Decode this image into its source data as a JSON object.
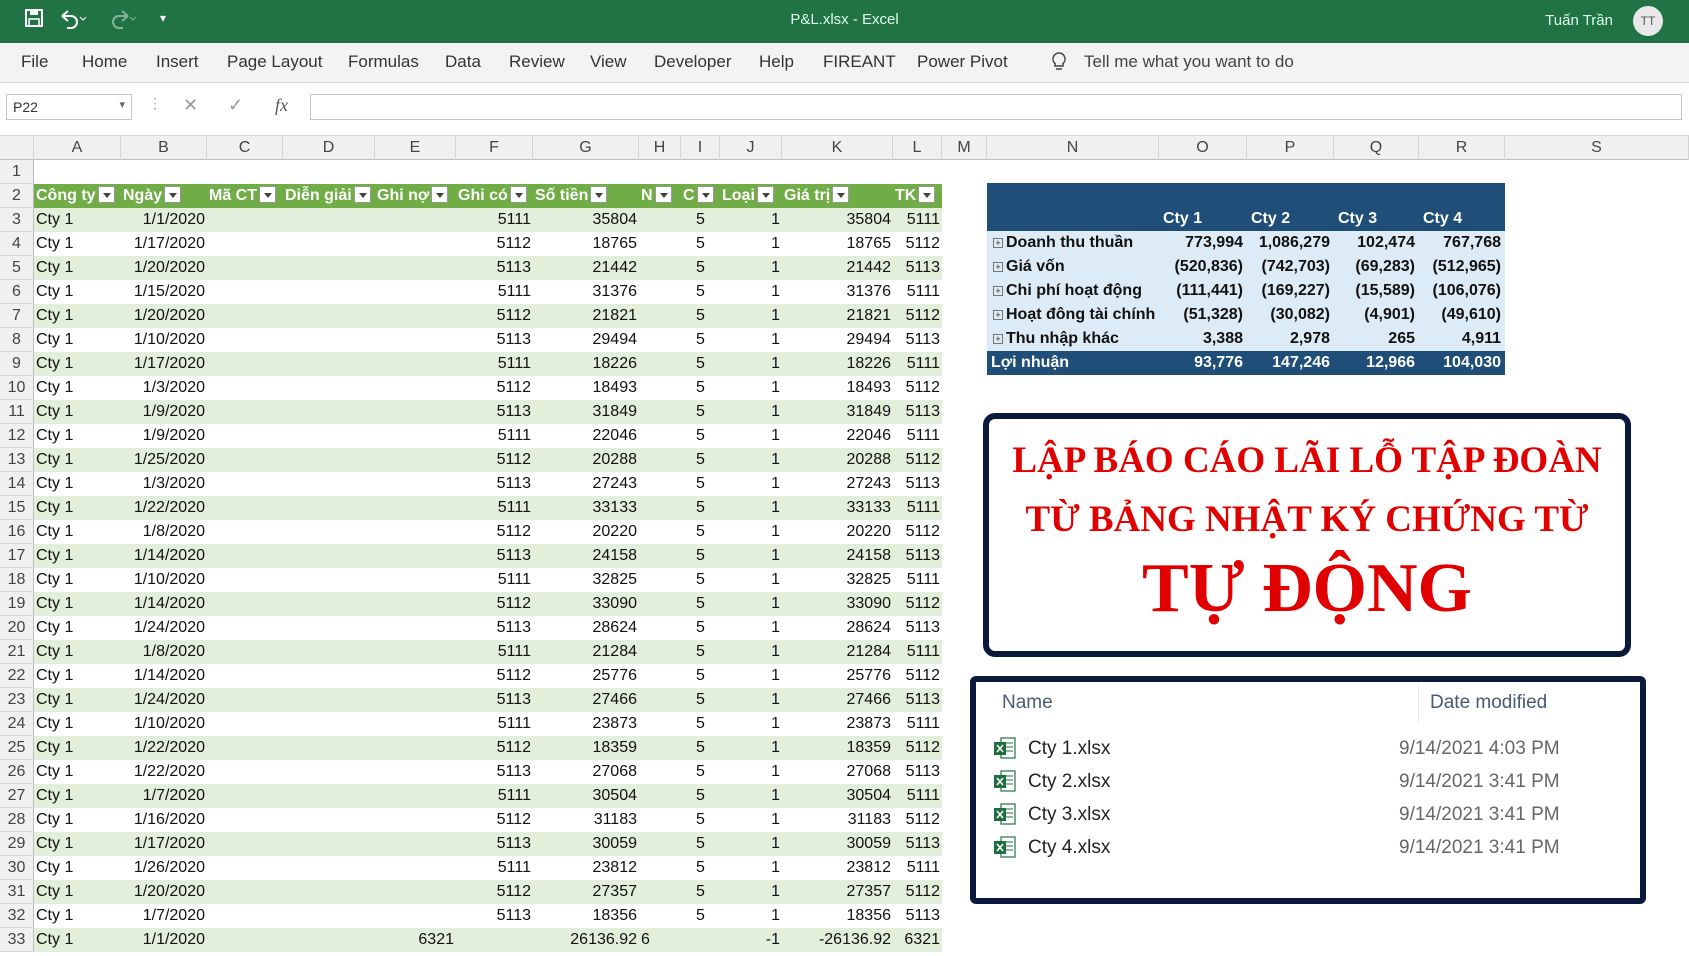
{
  "title_bar": {
    "doc_title": "P&L.xlsx  -  Excel",
    "user_name": "Tuấn Trần",
    "user_initials": "TT"
  },
  "menu": [
    "File",
    "Home",
    "Insert",
    "Page Layout",
    "Formulas",
    "Data",
    "Review",
    "View",
    "Developer",
    "Help",
    "FIREANT",
    "Power Pivot"
  ],
  "tell_me": "Tell me what you want to do",
  "name_box": "P22",
  "fx_label": "fx",
  "columns": [
    "A",
    "B",
    "C",
    "D",
    "E",
    "F",
    "G",
    "H",
    "I",
    "J",
    "K",
    "L",
    "M",
    "N",
    "O",
    "P",
    "Q",
    "R",
    "S"
  ],
  "row_numbers": [
    "1",
    "2",
    "3",
    "4",
    "5",
    "6",
    "7",
    "8",
    "9",
    "10",
    "11",
    "12",
    "13",
    "14",
    "15",
    "16",
    "17",
    "18",
    "19",
    "20",
    "21",
    "22",
    "23",
    "24",
    "25",
    "26",
    "27",
    "28",
    "29",
    "30",
    "31",
    "32",
    "33"
  ],
  "table": {
    "headers": [
      "Công ty",
      "Ngày",
      "Mã CT",
      "Diễn giải",
      "Ghi nợ",
      "Ghi có",
      "Số tiền",
      "N",
      "C",
      "Loại",
      "Giá trị",
      "TK"
    ],
    "rows": [
      [
        "Cty 1",
        "1/1/2020",
        "",
        "",
        "",
        "5111",
        "35804",
        "",
        "5",
        "1",
        "35804",
        "5111"
      ],
      [
        "Cty 1",
        "1/17/2020",
        "",
        "",
        "",
        "5112",
        "18765",
        "",
        "5",
        "1",
        "18765",
        "5112"
      ],
      [
        "Cty 1",
        "1/20/2020",
        "",
        "",
        "",
        "5113",
        "21442",
        "",
        "5",
        "1",
        "21442",
        "5113"
      ],
      [
        "Cty 1",
        "1/15/2020",
        "",
        "",
        "",
        "5111",
        "31376",
        "",
        "5",
        "1",
        "31376",
        "5111"
      ],
      [
        "Cty 1",
        "1/20/2020",
        "",
        "",
        "",
        "5112",
        "21821",
        "",
        "5",
        "1",
        "21821",
        "5112"
      ],
      [
        "Cty 1",
        "1/10/2020",
        "",
        "",
        "",
        "5113",
        "29494",
        "",
        "5",
        "1",
        "29494",
        "5113"
      ],
      [
        "Cty 1",
        "1/17/2020",
        "",
        "",
        "",
        "5111",
        "18226",
        "",
        "5",
        "1",
        "18226",
        "5111"
      ],
      [
        "Cty 1",
        "1/3/2020",
        "",
        "",
        "",
        "5112",
        "18493",
        "",
        "5",
        "1",
        "18493",
        "5112"
      ],
      [
        "Cty 1",
        "1/9/2020",
        "",
        "",
        "",
        "5113",
        "31849",
        "",
        "5",
        "1",
        "31849",
        "5113"
      ],
      [
        "Cty 1",
        "1/9/2020",
        "",
        "",
        "",
        "5111",
        "22046",
        "",
        "5",
        "1",
        "22046",
        "5111"
      ],
      [
        "Cty 1",
        "1/25/2020",
        "",
        "",
        "",
        "5112",
        "20288",
        "",
        "5",
        "1",
        "20288",
        "5112"
      ],
      [
        "Cty 1",
        "1/3/2020",
        "",
        "",
        "",
        "5113",
        "27243",
        "",
        "5",
        "1",
        "27243",
        "5113"
      ],
      [
        "Cty 1",
        "1/22/2020",
        "",
        "",
        "",
        "5111",
        "33133",
        "",
        "5",
        "1",
        "33133",
        "5111"
      ],
      [
        "Cty 1",
        "1/8/2020",
        "",
        "",
        "",
        "5112",
        "20220",
        "",
        "5",
        "1",
        "20220",
        "5112"
      ],
      [
        "Cty 1",
        "1/14/2020",
        "",
        "",
        "",
        "5113",
        "24158",
        "",
        "5",
        "1",
        "24158",
        "5113"
      ],
      [
        "Cty 1",
        "1/10/2020",
        "",
        "",
        "",
        "5111",
        "32825",
        "",
        "5",
        "1",
        "32825",
        "5111"
      ],
      [
        "Cty 1",
        "1/14/2020",
        "",
        "",
        "",
        "5112",
        "33090",
        "",
        "5",
        "1",
        "33090",
        "5112"
      ],
      [
        "Cty 1",
        "1/24/2020",
        "",
        "",
        "",
        "5113",
        "28624",
        "",
        "5",
        "1",
        "28624",
        "5113"
      ],
      [
        "Cty 1",
        "1/8/2020",
        "",
        "",
        "",
        "5111",
        "21284",
        "",
        "5",
        "1",
        "21284",
        "5111"
      ],
      [
        "Cty 1",
        "1/14/2020",
        "",
        "",
        "",
        "5112",
        "25776",
        "",
        "5",
        "1",
        "25776",
        "5112"
      ],
      [
        "Cty 1",
        "1/24/2020",
        "",
        "",
        "",
        "5113",
        "27466",
        "",
        "5",
        "1",
        "27466",
        "5113"
      ],
      [
        "Cty 1",
        "1/10/2020",
        "",
        "",
        "",
        "5111",
        "23873",
        "",
        "5",
        "1",
        "23873",
        "5111"
      ],
      [
        "Cty 1",
        "1/22/2020",
        "",
        "",
        "",
        "5112",
        "18359",
        "",
        "5",
        "1",
        "18359",
        "5112"
      ],
      [
        "Cty 1",
        "1/22/2020",
        "",
        "",
        "",
        "5113",
        "27068",
        "",
        "5",
        "1",
        "27068",
        "5113"
      ],
      [
        "Cty 1",
        "1/7/2020",
        "",
        "",
        "",
        "5111",
        "30504",
        "",
        "5",
        "1",
        "30504",
        "5111"
      ],
      [
        "Cty 1",
        "1/16/2020",
        "",
        "",
        "",
        "5112",
        "31183",
        "",
        "5",
        "1",
        "31183",
        "5112"
      ],
      [
        "Cty 1",
        "1/17/2020",
        "",
        "",
        "",
        "5113",
        "30059",
        "",
        "5",
        "1",
        "30059",
        "5113"
      ],
      [
        "Cty 1",
        "1/26/2020",
        "",
        "",
        "",
        "5111",
        "23812",
        "",
        "5",
        "1",
        "23812",
        "5111"
      ],
      [
        "Cty 1",
        "1/20/2020",
        "",
        "",
        "",
        "5112",
        "27357",
        "",
        "5",
        "1",
        "27357",
        "5112"
      ],
      [
        "Cty 1",
        "1/7/2020",
        "",
        "",
        "",
        "5113",
        "18356",
        "",
        "5",
        "1",
        "18356",
        "5113"
      ],
      [
        "Cty 1",
        "1/1/2020",
        "",
        "",
        "6321",
        "",
        "26136.92",
        "6",
        "",
        "-1",
        "-26136.92",
        "6321"
      ]
    ]
  },
  "pivot": {
    "headers": [
      "Cty 1",
      "Cty 2",
      "Cty 3",
      "Cty 4"
    ],
    "rows": [
      {
        "label": "Doanh thu thuần",
        "values": [
          "773,994",
          "1,086,279",
          "102,474",
          "767,768"
        ]
      },
      {
        "label": "Giá vốn",
        "values": [
          "(520,836)",
          "(742,703)",
          "(69,283)",
          "(512,965)"
        ]
      },
      {
        "label": "Chi phí hoạt động",
        "values": [
          "(111,441)",
          "(169,227)",
          "(15,589)",
          "(106,076)"
        ]
      },
      {
        "label": "Hoạt đông tài chính",
        "values": [
          "(51,328)",
          "(30,082)",
          "(4,901)",
          "(49,610)"
        ]
      },
      {
        "label": "Thu nhập khác",
        "values": [
          "3,388",
          "2,978",
          "265",
          "4,911"
        ]
      }
    ],
    "total": {
      "label": "Lợi nhuận",
      "values": [
        "93,776",
        "147,246",
        "12,966",
        "104,030"
      ]
    }
  },
  "banner": {
    "line1": "LẬP BÁO CÁO LÃI LỖ TẬP ĐOÀN",
    "line2": "TỪ BẢNG NHẬT KÝ CHỨNG TỪ",
    "line3": "TỰ ĐỘNG"
  },
  "explorer": {
    "col_name": "Name",
    "col_date": "Date modified",
    "files": [
      {
        "name": "Cty 1.xlsx",
        "date": "9/14/2021 4:03 PM"
      },
      {
        "name": "Cty 2.xlsx",
        "date": "9/14/2021 3:41 PM"
      },
      {
        "name": "Cty 3.xlsx",
        "date": "9/14/2021 3:41 PM"
      },
      {
        "name": "Cty 4.xlsx",
        "date": "9/14/2021 3:41 PM"
      }
    ]
  },
  "colors": {
    "excel_green": "#217346",
    "table_header": "#70ad47",
    "table_band": "#e2efda",
    "pivot_header": "#1f4e79",
    "pivot_row": "#ddebf7",
    "banner_red": "#e10000"
  }
}
